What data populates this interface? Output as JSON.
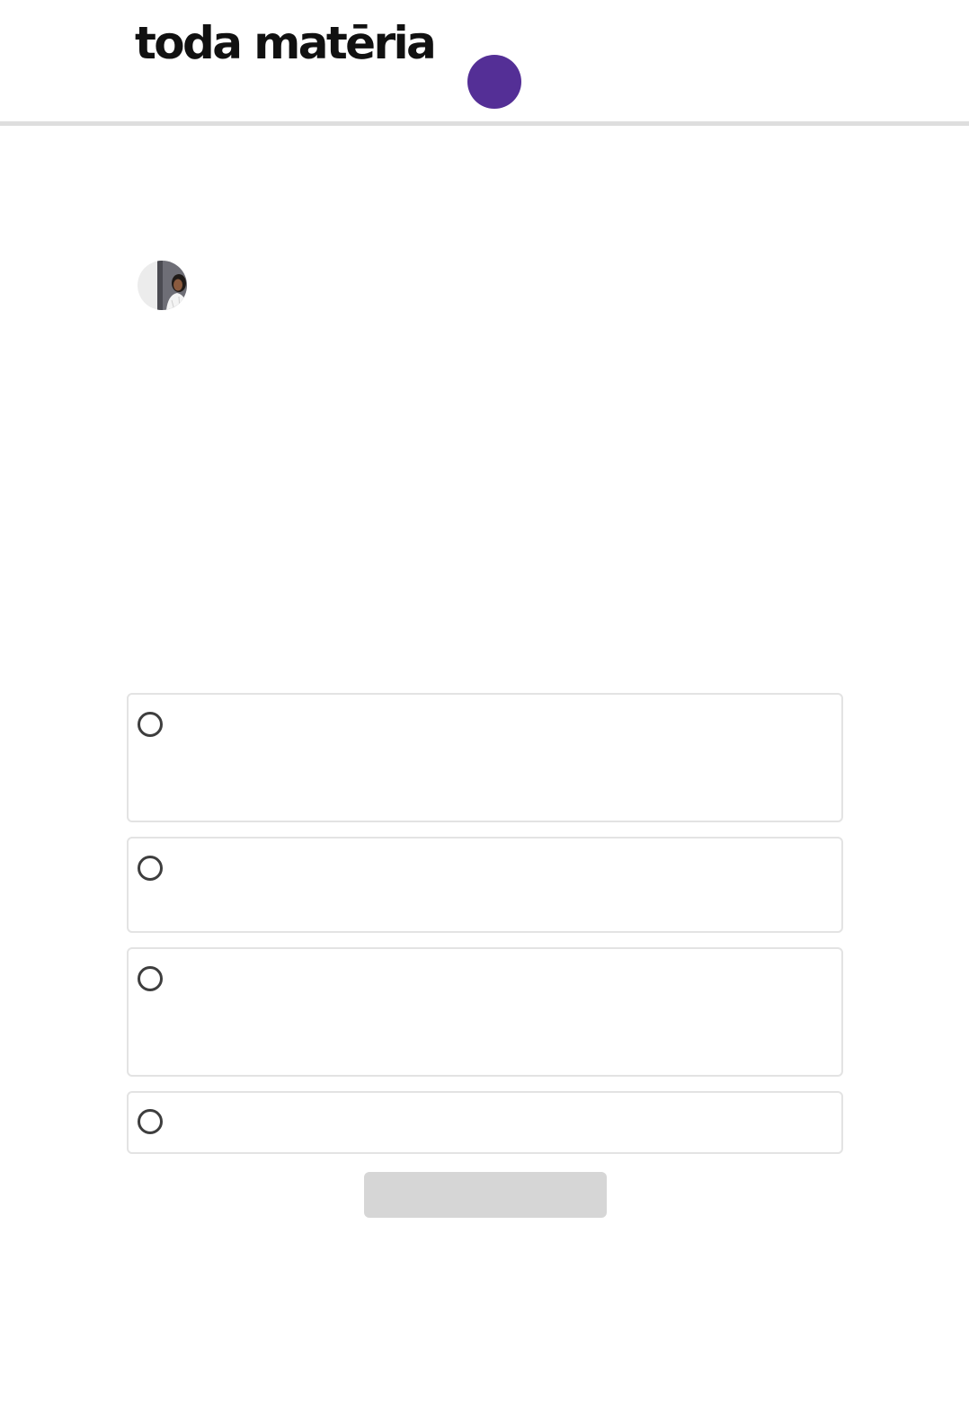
{
  "header": {
    "logo_text": "toda matēria"
  },
  "colors": {
    "accent": "#542f96",
    "divider": "#dedede",
    "option_border": "#e3e3e3",
    "radio_ring": "#3e3e3e",
    "button_disabled": "#d6d6d6"
  },
  "icons": {
    "avatar": "author-photo",
    "radio": "radio-unchecked-icon"
  },
  "quiz": {
    "options": [
      {
        "label": "",
        "selected": false
      },
      {
        "label": "",
        "selected": false
      },
      {
        "label": "",
        "selected": false
      },
      {
        "label": "",
        "selected": false
      }
    ],
    "submit_label": ""
  }
}
